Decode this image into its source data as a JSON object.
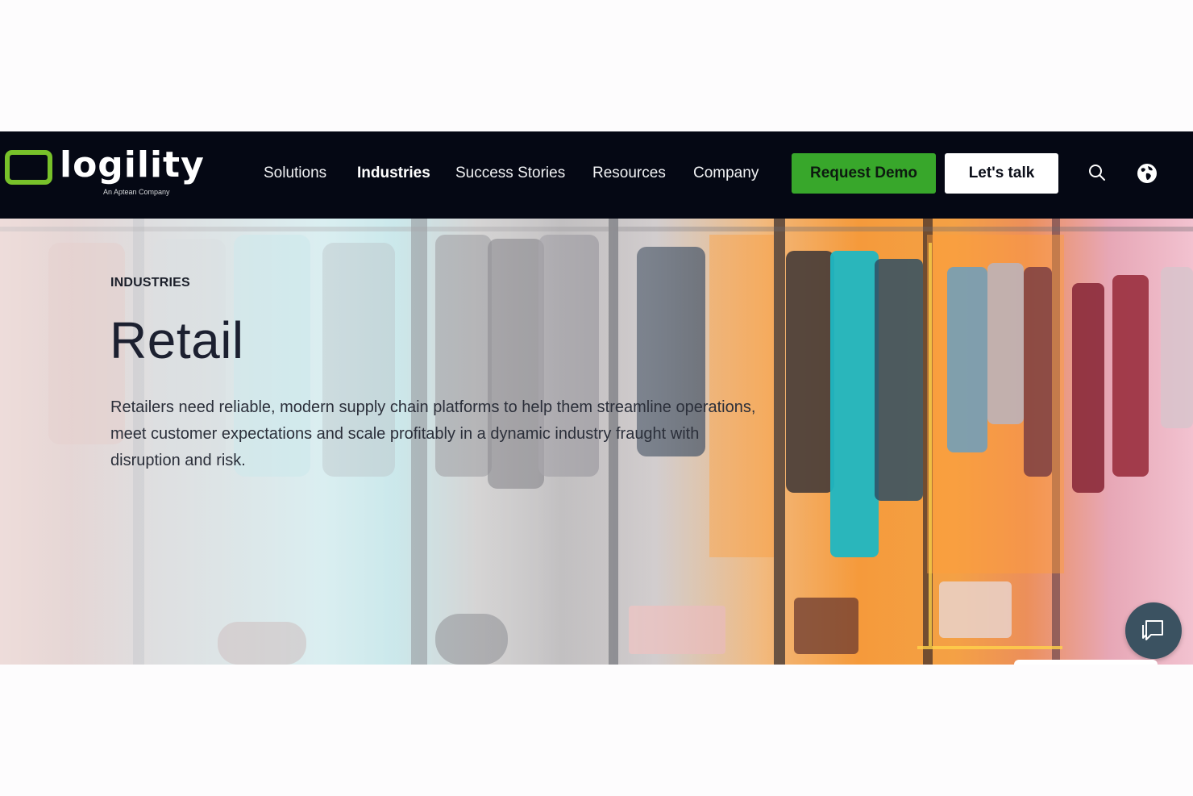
{
  "header": {
    "logo": {
      "wordmark": "logility",
      "tagline": "An Aptean Company",
      "accent_color": "#78c12a"
    },
    "nav": [
      {
        "label": "Solutions",
        "active": false
      },
      {
        "label": "Industries",
        "active": true
      },
      {
        "label": "Success Stories",
        "active": false
      },
      {
        "label": "Resources",
        "active": false
      },
      {
        "label": "Company",
        "active": false
      }
    ],
    "request_demo_label": "Request Demo",
    "lets_talk_label": "Let's talk",
    "search_icon": "search-icon",
    "globe_icon": "globe-icon",
    "background_color": "#050814",
    "demo_button_color": "#38a72b"
  },
  "hero": {
    "eyebrow": "INDUSTRIES",
    "title": "Retail",
    "description": "Retailers need reliable, modern supply chain platforms to help them streamline operations, meet customer expectations and scale profitably in a dynamic industry fraught with disruption and risk."
  },
  "chat": {
    "icon": "chat-bubble-icon",
    "color": "#3b5261"
  }
}
